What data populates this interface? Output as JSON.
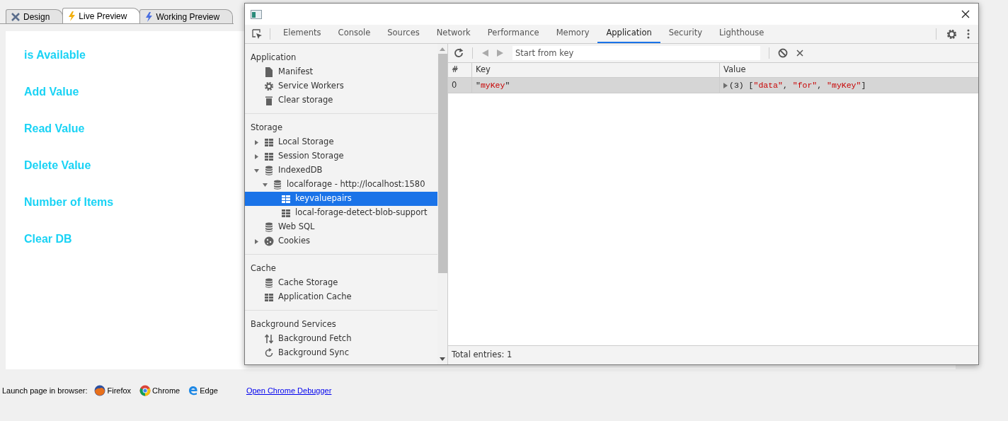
{
  "editor_tabs": [
    {
      "label": "Design",
      "kind": "design",
      "selected": false
    },
    {
      "label": "Live Preview",
      "kind": "live",
      "selected": true
    },
    {
      "label": "Working Preview",
      "kind": "working",
      "selected": false
    }
  ],
  "preview_links": [
    "is Available",
    "Add Value",
    "Read Value",
    "Delete Value",
    "Number of Items",
    "Clear DB"
  ],
  "launch_bar": {
    "label": "Launch page in browser:",
    "browsers": [
      {
        "label": "Firefox",
        "kind": "firefox"
      },
      {
        "label": "Chrome",
        "kind": "chrome"
      },
      {
        "label": "Edge",
        "kind": "edge"
      }
    ],
    "debugger_link": "Open Chrome Debugger"
  },
  "devtools": {
    "tabs": [
      {
        "label": "Elements",
        "selected": false
      },
      {
        "label": "Console",
        "selected": false
      },
      {
        "label": "Sources",
        "selected": false
      },
      {
        "label": "Network",
        "selected": false
      },
      {
        "label": "Performance",
        "selected": false
      },
      {
        "label": "Memory",
        "selected": false
      },
      {
        "label": "Application",
        "selected": true
      },
      {
        "label": "Security",
        "selected": false
      },
      {
        "label": "Lighthouse",
        "selected": false
      }
    ],
    "sidebar": [
      {
        "title": "Application",
        "items": [
          {
            "label": "Manifest",
            "kind": "file",
            "selected": false
          },
          {
            "label": "Service Workers",
            "kind": "gear",
            "selected": false
          },
          {
            "label": "Clear storage",
            "kind": "bin",
            "selected": false
          }
        ]
      },
      {
        "title": "Storage",
        "items": [
          {
            "label": "Local Storage",
            "kind": "grid",
            "selected": false,
            "expanded": false
          },
          {
            "label": "Session Storage",
            "kind": "grid",
            "selected": false,
            "expanded": false
          },
          {
            "label": "IndexedDB",
            "kind": "db",
            "selected": false,
            "expanded": true,
            "children": [
              {
                "label": "localforage - http://localhost:1580",
                "kind": "db",
                "selected": false,
                "expanded": true,
                "children": [
                  {
                    "label": "keyvaluepairs",
                    "kind": "grid",
                    "selected": true
                  },
                  {
                    "label": "local-forage-detect-blob-support",
                    "kind": "grid",
                    "selected": false
                  }
                ]
              }
            ]
          },
          {
            "label": "Web SQL",
            "kind": "db",
            "selected": false
          },
          {
            "label": "Cookies",
            "kind": "cookie",
            "selected": false,
            "expanded": false
          }
        ]
      },
      {
        "title": "Cache",
        "items": [
          {
            "label": "Cache Storage",
            "kind": "db",
            "selected": false
          },
          {
            "label": "Application Cache",
            "kind": "grid",
            "selected": false
          }
        ]
      },
      {
        "title": "Background Services",
        "items": [
          {
            "label": "Background Fetch",
            "kind": "updown",
            "selected": false
          },
          {
            "label": "Background Sync",
            "kind": "sync",
            "selected": false
          }
        ]
      }
    ],
    "search": {
      "placeholder": "Start from key"
    },
    "table": {
      "columns": [
        "#",
        "Key",
        "Value"
      ],
      "rows": [
        {
          "selected": true,
          "index": "0",
          "key": [
            {
              "text": "\"",
              "kind": "plain"
            },
            {
              "text": "myKey",
              "kind": "string"
            },
            {
              "text": "\"",
              "kind": "plain"
            }
          ],
          "value": [
            {
              "text": "(3) [",
              "kind": "plain"
            },
            {
              "text": "\"data\"",
              "kind": "string"
            },
            {
              "text": ", ",
              "kind": "plain"
            },
            {
              "text": "\"for\"",
              "kind": "string"
            },
            {
              "text": ", ",
              "kind": "plain"
            },
            {
              "text": "\"myKey\"",
              "kind": "string"
            },
            {
              "text": "]",
              "kind": "plain"
            }
          ]
        }
      ]
    },
    "status": "Total entries: 1"
  }
}
